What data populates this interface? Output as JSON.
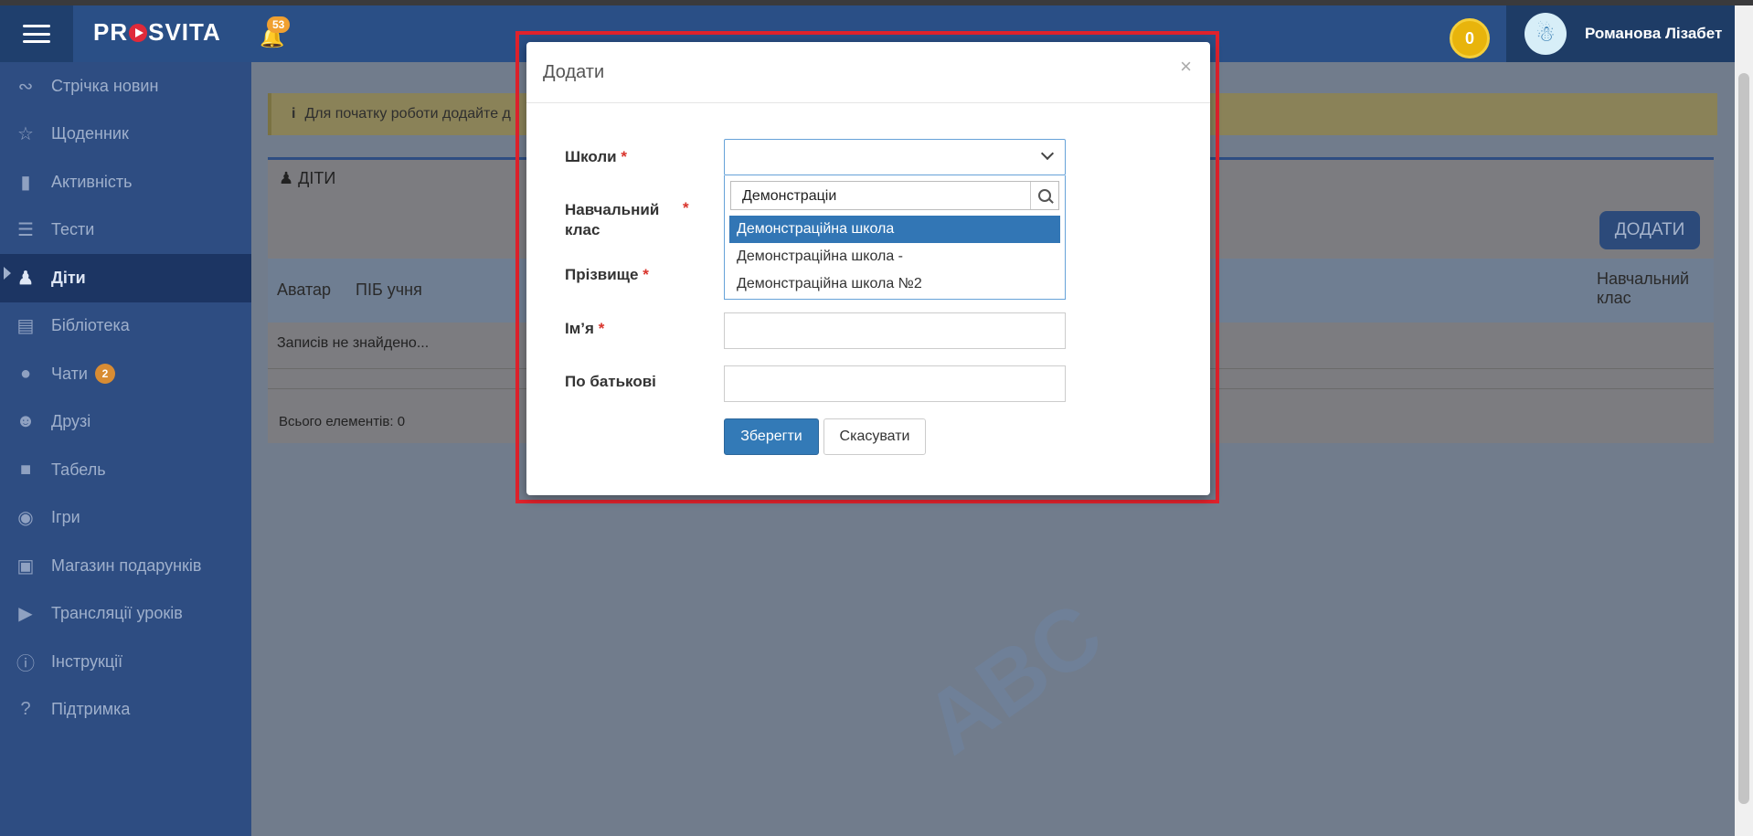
{
  "app": {
    "logo_text_1": "PR",
    "logo_text_2": "SVITA"
  },
  "header": {
    "notification_count": "53",
    "coins": "0",
    "user_name": "Романова Лізабет"
  },
  "sidebar": {
    "items": [
      {
        "label": "Стрічка новин",
        "icon": "rss-icon"
      },
      {
        "label": "Щоденник",
        "icon": "star-icon"
      },
      {
        "label": "Активність",
        "icon": "file-icon"
      },
      {
        "label": "Тести",
        "icon": "list-icon"
      },
      {
        "label": "Діти",
        "icon": "child-icon"
      },
      {
        "label": "Бібліотека",
        "icon": "book-icon"
      },
      {
        "label": "Чати",
        "icon": "chat-icon",
        "badge": "2"
      },
      {
        "label": "Друзі",
        "icon": "users-icon"
      },
      {
        "label": "Табель",
        "icon": "folder-icon"
      },
      {
        "label": "Ігри",
        "icon": "gamepad-icon"
      },
      {
        "label": "Магазин подарунків",
        "icon": "gift-icon"
      },
      {
        "label": "Трансляції уроків",
        "icon": "video-icon"
      },
      {
        "label": "Інструкції",
        "icon": "info-icon"
      },
      {
        "label": "Підтримка",
        "icon": "help-icon"
      }
    ]
  },
  "main": {
    "alert_text": "Для початку роботи додайте д",
    "panel_title": "ДІТИ",
    "add_button": "ДОДАТИ",
    "columns": {
      "avatar": "Аватар",
      "name": "ПІБ учня",
      "class": "Навчальний клас"
    },
    "empty_text": "Записів не знайдено...",
    "total_text": "Всього елементів: 0"
  },
  "modal": {
    "title": "Додати",
    "close": "×",
    "labels": {
      "schools": "Школи",
      "class": "Навчальний клас",
      "surname": "Прізвище",
      "name": "Ім’я",
      "patronymic": "По батькові"
    },
    "required_mark": "*",
    "search_value": "Демонстраціи",
    "options": [
      "Демонстраційна школа",
      "Демонстраційна школа -",
      "Демонстраційна школа №2"
    ],
    "selected_option_index": 0,
    "save_button": "Зберегти",
    "cancel_button": "Скасувати"
  },
  "colors": {
    "sidebar_bg": "#2e4d82",
    "topbar_bg": "#2a4f86",
    "primary_button": "#337ab7",
    "highlight_border": "#e0222c"
  }
}
